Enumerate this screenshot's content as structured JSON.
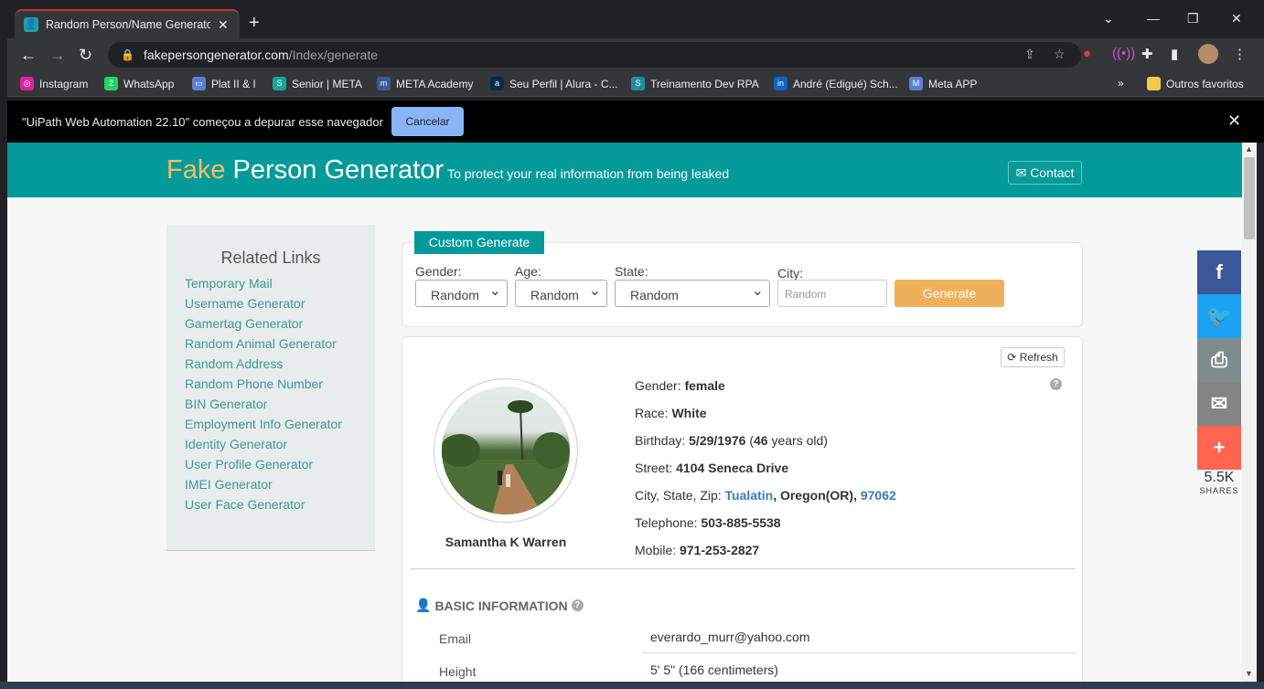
{
  "browser": {
    "tab_title": "Random Person/Name Generator",
    "tab_close": "✕",
    "new_tab": "+",
    "url_domain": "fakepersongenerator.com",
    "url_path": "/Index/generate",
    "bookmarks": [
      {
        "label": "Instagram",
        "color": "#d6249f",
        "glyph": "◎"
      },
      {
        "label": "WhatsApp",
        "color": "#25d366",
        "glyph": "2"
      },
      {
        "label": "Plat II & I",
        "color": "#5b7fd1",
        "glyph": "▭"
      },
      {
        "label": "Senior | META",
        "color": "#1aa39a",
        "glyph": "S"
      },
      {
        "label": "META Academy",
        "color": "#3b5998",
        "glyph": "m"
      },
      {
        "label": "Seu Perfil | Alura - C...",
        "color": "#0b2a4a",
        "glyph": "a"
      },
      {
        "label": "Treinamento Dev RPA",
        "color": "#1f8ea3",
        "glyph": "S"
      },
      {
        "label": "André (Edigué) Sch...",
        "color": "#0a66c2",
        "glyph": "in"
      },
      {
        "label": "Meta APP",
        "color": "#5b7fd1",
        "glyph": "M"
      }
    ],
    "bookmarks_more": "»",
    "other_bookmarks": "Outros favoritos"
  },
  "debug_bar": {
    "message": "\"UiPath Web Automation 22.10\" começou a depurar esse navegador",
    "cancel": "Cancelar",
    "close": "✕"
  },
  "site": {
    "logo_fake": "Fake",
    "logo_rest": " Person Generator",
    "tagline": "To protect your real information from being leaked",
    "contact": "Contact"
  },
  "sidebar": {
    "title": "Related Links",
    "links": [
      "Temporary Mail",
      "Username Generator",
      "Gamertag Generator",
      "Random Animal Generator",
      "Random Address",
      "Random Phone Number",
      "BIN Generator",
      "Employment Info Generator",
      "Identity Generator",
      "User Profile Generator",
      "IMEI Generator",
      "User Face Generator"
    ]
  },
  "form": {
    "title": "Custom Generate",
    "gender_label": "Gender:",
    "gender_value": "Random",
    "age_label": "Age:",
    "age_value": "Random",
    "state_label": "State:",
    "state_value": "Random",
    "city_label": "City:",
    "city_placeholder": "Random",
    "generate": "Generate"
  },
  "person": {
    "refresh": "Refresh",
    "name": "Samantha K Warren",
    "gender_label": "Gender: ",
    "gender": "female",
    "race_label": "Race: ",
    "race": "White",
    "birthday_label": "Birthday: ",
    "birthday": "5/29/1976",
    "age_open": " (",
    "age": "46",
    "age_rest": " years old)",
    "street_label": "Street: ",
    "street": "4104 Seneca Drive",
    "csz_label": "City, State, Zip: ",
    "city": "Tualatin",
    "sep1": ", ",
    "state": "Oregon(OR)",
    "sep2": ", ",
    "zip": "97062",
    "telephone_label": "Telephone: ",
    "telephone": "503-885-5538",
    "mobile_label": "Mobile: ",
    "mobile": "971-253-2827"
  },
  "basic": {
    "title": "BASIC INFORMATION",
    "email_label": "Email",
    "email": "everardo_murr@yahoo.com",
    "height_label": "Height",
    "height": "5' 5\" (166 centimeters)"
  },
  "share": {
    "count": "5.5K",
    "label": "SHARES",
    "buttons": [
      {
        "name": "facebook",
        "glyph": "f",
        "color": "#3b5998"
      },
      {
        "name": "twitter",
        "glyph": "🐦",
        "color": "#1da1f2"
      },
      {
        "name": "print",
        "glyph": "⎙",
        "color": "#7f8c8d"
      },
      {
        "name": "email",
        "glyph": "✉",
        "color": "#848484"
      },
      {
        "name": "more",
        "glyph": "+",
        "color": "#ff6550"
      }
    ]
  }
}
